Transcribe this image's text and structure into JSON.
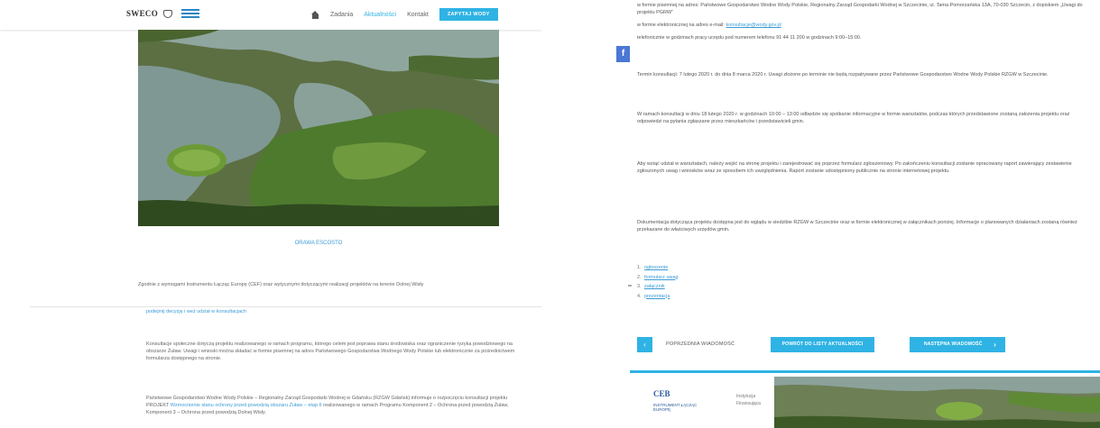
{
  "colors": {
    "accent": "#2fb3e4",
    "link": "#3a9bd6",
    "facebook": "#4a78d4",
    "footer_brand": "#2b5a9c"
  },
  "header": {
    "logo_text": "SWECO",
    "nav": {
      "home_icon": "home-icon",
      "items": [
        "Zadania",
        "Aktualności",
        "Kontakt"
      ],
      "active_index": 1,
      "cta": "ZAPYTAJ WODY"
    }
  },
  "left": {
    "photo_caption": "ORAWA ESCOSTO",
    "paragraph_1": "Zgodnie z wymogami Instrumentu Łącząc Europę (CEF) oraz wytycznymi dotyczącymi realizacji projektów na terenie Dolnej Wisły",
    "link_1": "podejmij decyzję i weź udział w konsultacjach",
    "paragraph_2": "Konsultacje społeczne dotyczą projektu realizowanego w ramach programu, którego celem jest poprawa stanu środowiska oraz ograniczenie ryzyka powodziowego na obszarze Żuław. Uwagi i wnioski można składać w formie pisemnej na adres Państwowego Gospodarstwa Wodnego Wody Polskie lub elektronicznie za pośrednictwem formularza dostępnego na stronie.",
    "paragraph_3_a": "Państwowe Gospodarstwo Wodne Wody Polskie – Regionalny Zarząd Gospodarki Wodnej w Gdańsku (RZGW Gdańsk) informuje o rozpoczęciu konsultacji projektu PROJEKT",
    "paragraph_3_link": "Wzmocnienie stanu ochrony przed powodzią obszaru Żuław – etap II",
    "paragraph_3_b": "realizowanego w ramach Programu Komponent 2 – Ochrona przed powodzią Żuław, Komponent 3 – Ochrona przed powodzią Dolnej Wisły."
  },
  "right": {
    "facebook_label": "f",
    "bullets": [
      {
        "text": "w formie pisemnej na adres: Państwowe Gospodarstwo Wodne Wody Polskie, Regionalny Zarząd Gospodarki Wodnej w Szczecinie, ul. Tama Pomorzańska 13A, 70-030 Szczecin, z dopiskiem „Uwagi do projektu PGRW”",
        "link": ""
      },
      {
        "text": "w formie elektronicznej na adres e-mail:",
        "link": "konsultacje@wody.gov.pl"
      },
      {
        "text": "telefonicznie w godzinach pracy urzędu pod numerem telefonu 91 44 11 200 w godzinach 9:00–15:00.",
        "link": ""
      }
    ],
    "paragraph_1": "Termin konsultacji: 7 lutego 2020 r. do dnia 8 marca 2020 r. Uwagi złożone po terminie nie będą rozpatrywane przez Państwowe Gospodarstwo Wodne Wody Polskie RZGW w Szczecinie.",
    "paragraph_2": "W ramach konsultacji w dniu 18 lutego 2020 r. w godzinach 10:00 – 13:00 odbędzie się spotkanie informacyjne w formie warsztatów, podczas których przedstawione zostaną założenia projektu oraz odpowiedzi na pytania zgłaszane przez mieszkańców i przedstawicieli gmin.",
    "paragraph_3": "Aby wziąć udział w warsztatach, należy wejść na stronę projektu i zarejestrować się poprzez formularz zgłoszeniowy. Po zakończeniu konsultacji zostanie opracowany raport zawierający zestawienie zgłoszonych uwag i wniosków wraz ze sposobem ich uwzględnienia. Raport zostanie udostępniony publicznie na stronie internetowej projektu.",
    "paragraph_4": "Dokumentacja dotycząca projektu dostępna jest do wglądu w siedzibie RZGW w Szczecinie oraz w formie elektronicznej w załącznikach poniżej. Informacje o planowanych działaniach zostaną również przekazane do właściwych urzędów gmin.",
    "attachments": [
      {
        "num": "1.",
        "label": "ogłoszenie"
      },
      {
        "num": "2.",
        "label": "formularz uwag"
      },
      {
        "num": "3.",
        "label": "załącznik"
      },
      {
        "num": "4.",
        "label": "prezentacja"
      }
    ],
    "prev_label": "POPRZEDNIA WIADOMOŚĆ",
    "back_label": "POWRÓT DO LISTY AKTUALNOŚCI",
    "next_label": "NASTĘPNA WIADOMOŚĆ",
    "footer": {
      "brand": "CEB",
      "brand_sub": "INSTRUMENT ŁĄCZĄC EUROPĘ",
      "line_1": "Instytucja",
      "line_2": "Finansująca"
    }
  }
}
